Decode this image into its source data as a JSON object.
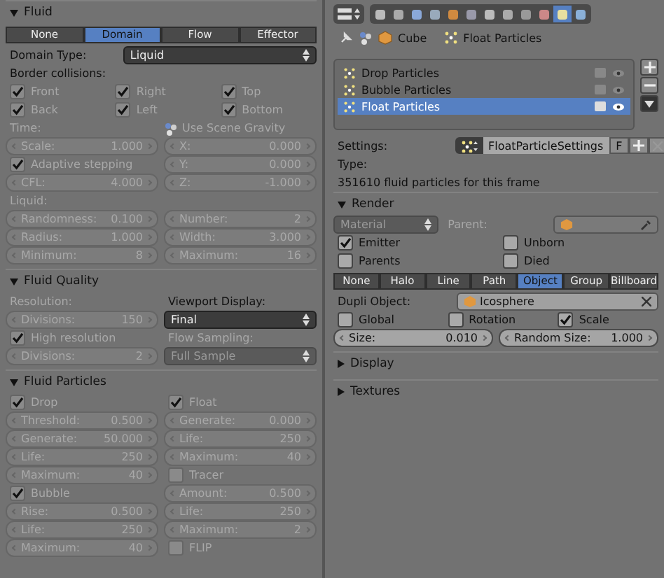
{
  "left": {
    "panels": [
      {
        "title": "Fluid",
        "expanded": true,
        "rows": [
          {
            "kind": "tabs",
            "tabs": [
              {
                "label": "None",
                "selected": false
              },
              {
                "label": "Domain",
                "selected": true
              },
              {
                "label": "Flow",
                "selected": false
              },
              {
                "label": "Effector",
                "selected": false
              }
            ]
          },
          {
            "kind": "labeled",
            "cells": [
              {
                "kind": "label",
                "text": "Domain Type:",
                "disabled": false
              },
              {
                "kind": "select",
                "value": "Liquid",
                "disabled": false
              }
            ]
          },
          {
            "kind": "grid",
            "cells": [
              {
                "kind": "label",
                "text": "Border collisions:",
                "disabled": false
              }
            ]
          },
          {
            "kind": "grid",
            "cells": [
              {
                "kind": "check",
                "label": "Front",
                "checked": true,
                "disabled": true
              },
              {
                "kind": "check",
                "label": "Right",
                "checked": true,
                "disabled": true
              },
              {
                "kind": "check",
                "label": "Top",
                "checked": true,
                "disabled": true
              }
            ]
          },
          {
            "kind": "grid",
            "cells": [
              {
                "kind": "check",
                "label": "Back",
                "checked": true,
                "disabled": true
              },
              {
                "kind": "check",
                "label": "Left",
                "checked": true,
                "disabled": true
              },
              {
                "kind": "check",
                "label": "Bottom",
                "checked": true,
                "disabled": true
              }
            ]
          },
          {
            "kind": "grid",
            "cells": [
              {
                "kind": "label",
                "text": "Time:",
                "disabled": true
              },
              {
                "kind": "gravity",
                "text": "Use Scene Gravity",
                "disabled": true
              }
            ]
          },
          {
            "kind": "grid",
            "cells": [
              {
                "kind": "num",
                "label": "Scale:",
                "value": "1.000",
                "disabled": true
              },
              {
                "kind": "num",
                "label": "X:",
                "value": "0.000",
                "disabled": true
              }
            ]
          },
          {
            "kind": "grid",
            "cells": [
              {
                "kind": "check",
                "label": "Adaptive stepping",
                "checked": true,
                "disabled": true
              },
              {
                "kind": "num",
                "label": "Y:",
                "value": "0.000",
                "disabled": true
              }
            ]
          },
          {
            "kind": "grid",
            "cells": [
              {
                "kind": "num",
                "label": "CFL:",
                "value": "4.000",
                "disabled": true
              },
              {
                "kind": "num",
                "label": "Z:",
                "value": "-1.000",
                "disabled": true
              }
            ]
          },
          {
            "kind": "grid",
            "cells": [
              {
                "kind": "label",
                "text": "Liquid:",
                "disabled": true
              }
            ]
          },
          {
            "kind": "grid",
            "cells": [
              {
                "kind": "num",
                "label": "Randomness:",
                "value": "0.100",
                "disabled": true
              },
              {
                "kind": "num",
                "label": "Number:",
                "value": "2",
                "disabled": true
              }
            ]
          },
          {
            "kind": "grid",
            "cells": [
              {
                "kind": "num",
                "label": "Radius:",
                "value": "1.000",
                "disabled": true
              },
              {
                "kind": "num",
                "label": "Width:",
                "value": "3.000",
                "disabled": true
              }
            ]
          },
          {
            "kind": "grid",
            "cells": [
              {
                "kind": "num",
                "label": "Minimum:",
                "value": "8",
                "disabled": true
              },
              {
                "kind": "num",
                "label": "Maximum:",
                "value": "16",
                "disabled": true
              }
            ]
          }
        ]
      },
      {
        "title": "Fluid Quality",
        "expanded": true,
        "rows": [
          {
            "kind": "grid",
            "cells": [
              {
                "kind": "label",
                "text": "Resolution:",
                "disabled": true
              },
              {
                "kind": "label",
                "text": "Viewport Display:",
                "disabled": false
              }
            ]
          },
          {
            "kind": "grid",
            "cells": [
              {
                "kind": "num",
                "label": "Divisions:",
                "value": "150",
                "disabled": true
              },
              {
                "kind": "select",
                "value": "Final",
                "disabled": false
              }
            ]
          },
          {
            "kind": "grid",
            "cells": [
              {
                "kind": "check",
                "label": "High resolution",
                "checked": true,
                "disabled": true
              },
              {
                "kind": "label",
                "text": "Flow Sampling:",
                "disabled": true
              }
            ]
          },
          {
            "kind": "grid",
            "cells": [
              {
                "kind": "num",
                "label": "Divisions:",
                "value": "2",
                "disabled": true
              },
              {
                "kind": "select",
                "value": "Full Sample",
                "disabled": true
              }
            ]
          }
        ]
      },
      {
        "title": "Fluid Particles",
        "expanded": true,
        "rows": [
          {
            "kind": "grid",
            "cells": [
              {
                "kind": "check",
                "label": "Drop",
                "checked": true,
                "disabled": true
              },
              {
                "kind": "check",
                "label": "Float",
                "checked": true,
                "disabled": true
              }
            ]
          },
          {
            "kind": "grid",
            "cells": [
              {
                "kind": "num",
                "label": "Threshold:",
                "value": "0.500",
                "disabled": true
              },
              {
                "kind": "num",
                "label": "Generate:",
                "value": "0.000",
                "disabled": true
              }
            ]
          },
          {
            "kind": "grid",
            "cells": [
              {
                "kind": "num",
                "label": "Generate:",
                "value": "50.000",
                "disabled": true
              },
              {
                "kind": "num",
                "label": "Life:",
                "value": "250",
                "disabled": true
              }
            ]
          },
          {
            "kind": "grid",
            "cells": [
              {
                "kind": "num",
                "label": "Life:",
                "value": "250",
                "disabled": true
              },
              {
                "kind": "num",
                "label": "Maximum:",
                "value": "40",
                "disabled": true
              }
            ]
          },
          {
            "kind": "grid",
            "cells": [
              {
                "kind": "num",
                "label": "Maximum:",
                "value": "40",
                "disabled": true
              },
              {
                "kind": "check",
                "label": "Tracer",
                "checked": false,
                "disabled": true
              }
            ]
          },
          {
            "kind": "grid",
            "cells": [
              {
                "kind": "check",
                "label": "Bubble",
                "checked": true,
                "disabled": true
              },
              {
                "kind": "num",
                "label": "Amount:",
                "value": "0.500",
                "disabled": true
              }
            ]
          },
          {
            "kind": "grid",
            "cells": [
              {
                "kind": "num",
                "label": "Rise:",
                "value": "0.500",
                "disabled": true
              },
              {
                "kind": "num",
                "label": "Life:",
                "value": "250",
                "disabled": true
              }
            ]
          },
          {
            "kind": "grid",
            "cells": [
              {
                "kind": "num",
                "label": "Life:",
                "value": "250",
                "disabled": true
              },
              {
                "kind": "num",
                "label": "Maximum:",
                "value": "2",
                "disabled": true
              }
            ]
          },
          {
            "kind": "grid",
            "cells": [
              {
                "kind": "num",
                "label": "Maximum:",
                "value": "40",
                "disabled": true
              },
              {
                "kind": "check",
                "label": "FLIP",
                "checked": false,
                "disabled": true
              }
            ]
          }
        ]
      }
    ]
  },
  "right": {
    "property_tabs": [
      {
        "selected": false
      },
      {
        "selected": false
      },
      {
        "selected": false
      },
      {
        "selected": false
      },
      {
        "selected": false
      },
      {
        "selected": false
      },
      {
        "selected": false
      },
      {
        "selected": false
      },
      {
        "selected": false
      },
      {
        "selected": false
      },
      {
        "selected": true
      },
      {
        "selected": false
      }
    ],
    "breadcrumb": {
      "object": "Cube",
      "item": "Float Particles"
    },
    "list": [
      {
        "label": "Drop Particles",
        "selected": false
      },
      {
        "label": "Bubble Particles",
        "selected": false
      },
      {
        "label": "Float Particles",
        "selected": true
      }
    ],
    "settings": {
      "label": "Settings:",
      "value": "FloatParticleSettings",
      "fake": "F"
    },
    "type_label": "Type:",
    "info": "351610 fluid particles for this frame",
    "panels": [
      {
        "title": "Render",
        "expanded": true,
        "rows": [
          {
            "kind": "grid",
            "cells": [
              {
                "kind": "select",
                "value": "Material",
                "disabled": true
              },
              {
                "kind": "label",
                "text": "Parent:",
                "disabled": true
              },
              {
                "kind": "object-pick",
                "disabled": true
              }
            ]
          },
          {
            "kind": "grid",
            "cells": [
              {
                "kind": "check",
                "label": "Emitter",
                "checked": true,
                "disabled": false
              },
              {
                "kind": "check",
                "label": "Unborn",
                "checked": false,
                "disabled": false
              }
            ]
          },
          {
            "kind": "grid",
            "cells": [
              {
                "kind": "check",
                "label": "Parents",
                "checked": false,
                "disabled": false
              },
              {
                "kind": "check",
                "label": "Died",
                "checked": false,
                "disabled": false
              }
            ]
          },
          {
            "kind": "tabs",
            "tabs": [
              {
                "label": "None",
                "selected": false
              },
              {
                "label": "Halo",
                "selected": false
              },
              {
                "label": "Line",
                "selected": false
              },
              {
                "label": "Path",
                "selected": false
              },
              {
                "label": "Object",
                "selected": true
              },
              {
                "label": "Group",
                "selected": false
              },
              {
                "label": "Billboard",
                "selected": false
              }
            ]
          },
          {
            "kind": "labeled",
            "cells": [
              {
                "kind": "label",
                "text": "Dupli Object:",
                "disabled": false
              },
              {
                "kind": "object-clear",
                "value": "Icosphere",
                "disabled": false
              }
            ]
          },
          {
            "kind": "grid",
            "cells": [
              {
                "kind": "check",
                "label": "Global",
                "checked": false,
                "disabled": false
              },
              {
                "kind": "check",
                "label": "Rotation",
                "checked": false,
                "disabled": false
              },
              {
                "kind": "check",
                "label": "Scale",
                "checked": true,
                "disabled": false
              }
            ]
          },
          {
            "kind": "grid",
            "cells": [
              {
                "kind": "num",
                "label": "Size:",
                "value": "0.010",
                "disabled": false
              },
              {
                "kind": "num",
                "label": "Random Size:",
                "value": "1.000",
                "disabled": false
              }
            ]
          }
        ]
      },
      {
        "title": "Display",
        "expanded": false
      },
      {
        "title": "Textures",
        "expanded": false
      }
    ]
  }
}
